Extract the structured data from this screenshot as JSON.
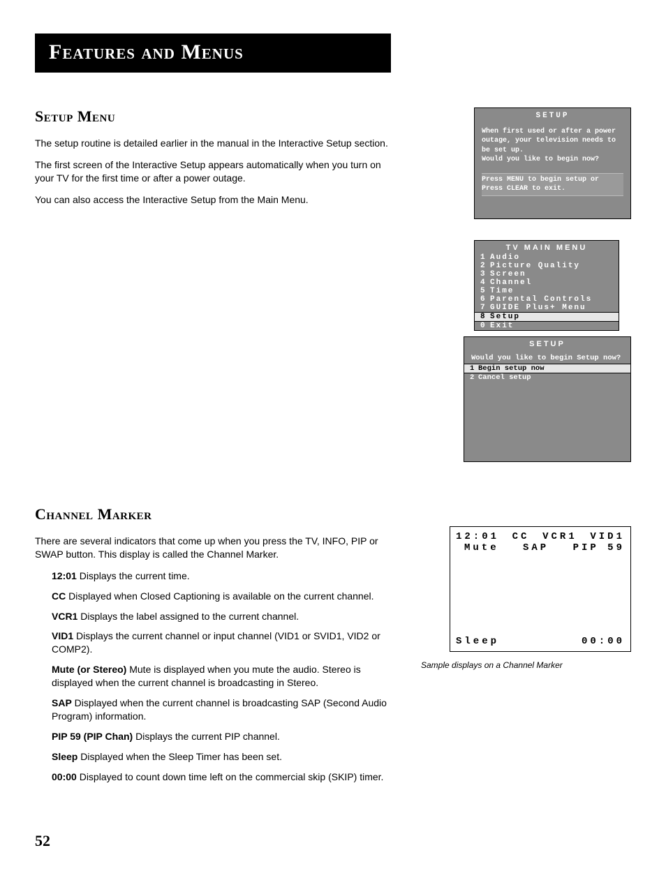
{
  "page": {
    "chapter_title": "Features and Menus",
    "page_number": "52"
  },
  "setup": {
    "heading": "Setup Menu",
    "p1": "The setup routine is detailed earlier in the manual in the Interactive Setup section.",
    "p2": "The first screen of the Interactive Setup appears automatically when you turn on your TV for the first time or after a power outage.",
    "p3": "You can also access the Interactive Setup from the Main Menu."
  },
  "osd_setup": {
    "title": "SETUP",
    "message": "When first used or after a power outage, your television needs to be set up.\nWould you like to begin now?",
    "hint": "Press MENU to begin setup or\nPress CLEAR to exit."
  },
  "osd_mainmenu": {
    "title": "TV MAIN MENU",
    "items": [
      {
        "n": "1",
        "label": "Audio"
      },
      {
        "n": "2",
        "label": "Picture Quality"
      },
      {
        "n": "3",
        "label": "Screen"
      },
      {
        "n": "4",
        "label": "Channel"
      },
      {
        "n": "5",
        "label": "Time"
      },
      {
        "n": "6",
        "label": "Parental Controls"
      },
      {
        "n": "7",
        "label": "GUIDE Plus+ Menu"
      },
      {
        "n": "8",
        "label": "Setup"
      },
      {
        "n": "0",
        "label": "Exit"
      }
    ],
    "selected_index": 7
  },
  "osd_setup2": {
    "title": "SETUP",
    "prompt": "Would you like to begin Setup now?",
    "options": [
      {
        "n": "1",
        "label": "Begin setup now"
      },
      {
        "n": "2",
        "label": "Cancel setup"
      }
    ],
    "selected_index": 0
  },
  "channel_marker": {
    "heading": "Channel Marker",
    "intro": "There are several indicators that come up when you press the TV, INFO, PIP or SWAP button. This display is called the Channel Marker.",
    "items": [
      {
        "term": "12:01",
        "desc": "  Displays the current time."
      },
      {
        "term": "CC",
        "desc": "  Displayed when Closed Captioning is available on the current channel."
      },
      {
        "term": "VCR1",
        "desc": "  Displays the label assigned to the current channel."
      },
      {
        "term": "VID1",
        "desc": " Displays the current channel or input channel (VID1 or SVID1, VID2 or COMP2)."
      },
      {
        "term": "Mute (or Stereo)",
        "desc": "   Mute is displayed when you mute the audio. Stereo is displayed when the current channel is broadcasting in Stereo."
      },
      {
        "term": "SAP",
        "desc": "  Displayed when the current channel is broadcasting SAP (Second Audio Program) information."
      },
      {
        "term": "PIP 59 (PIP Chan)",
        "desc": "  Displays the current PIP channel."
      },
      {
        "term": "Sleep",
        "desc": " Displayed when the Sleep Timer has been set."
      },
      {
        "term": "00:00",
        "desc": " Displayed to count down time left on the commercial skip (SKIP) timer."
      }
    ],
    "caption": "Sample displays on a Channel Marker"
  },
  "marker_display": {
    "row1": {
      "a": "12:01",
      "b": "CC",
      "c": "VCR1",
      "d": "VID1"
    },
    "row2": {
      "a": "Mute",
      "b": "SAP",
      "c": "PIP 59"
    },
    "row3": {
      "a": "Sleep",
      "b": "00:00"
    }
  }
}
